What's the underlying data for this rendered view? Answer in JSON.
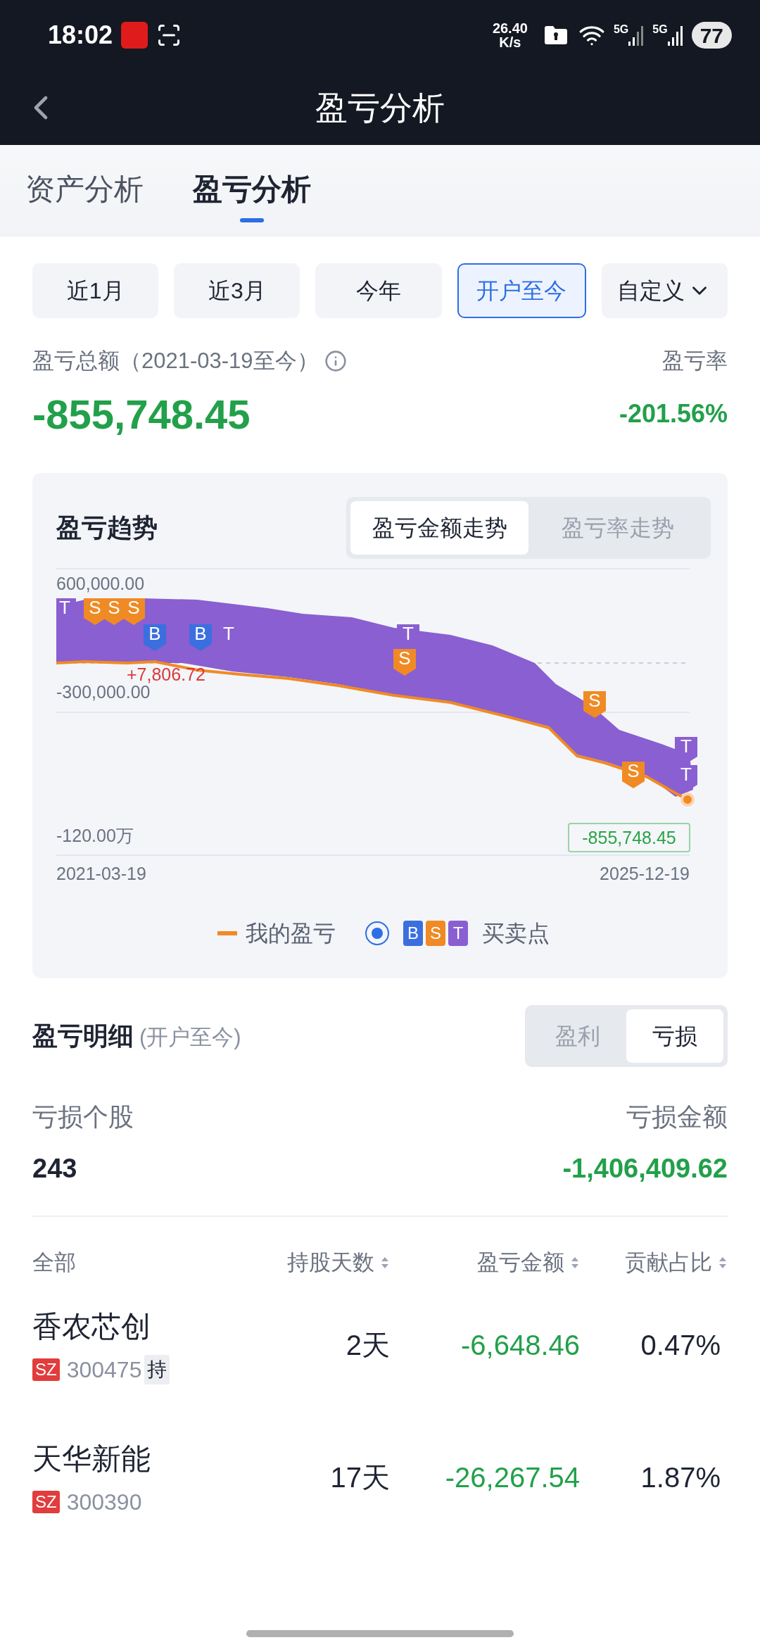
{
  "status_bar": {
    "time": "18:02",
    "speed_value": "26.40",
    "speed_unit": "K/s",
    "network_1": "5G",
    "network_2": "5G",
    "battery": "77"
  },
  "header": {
    "title": "盈亏分析"
  },
  "tabs": [
    {
      "label": "资产分析",
      "selected": false
    },
    {
      "label": "盈亏分析",
      "selected": true
    }
  ],
  "periods": [
    {
      "label": "近1月",
      "selected": false,
      "kind": "plain"
    },
    {
      "label": "近3月",
      "selected": false,
      "kind": "plain"
    },
    {
      "label": "今年",
      "selected": false,
      "kind": "plain"
    },
    {
      "label": "开户至今",
      "selected": true,
      "kind": "plain"
    },
    {
      "label": "自定义",
      "selected": false,
      "kind": "dropdown"
    }
  ],
  "summary": {
    "total_label": "盈亏总额（2021-03-19至今）",
    "total_value": "-855,748.45",
    "rate_label": "盈亏率",
    "rate_value": "-201.56%"
  },
  "trend": {
    "title": "盈亏趋势",
    "toggle": [
      {
        "label": "盈亏金额走势",
        "selected": true
      },
      {
        "label": "盈亏率走势",
        "selected": false
      }
    ],
    "y_labels": [
      "600,000.00",
      "-300,000.00",
      "-120.00万"
    ],
    "x_labels": [
      "2021-03-19",
      "2025-12-19"
    ],
    "max_label": "+7,806.72",
    "last_label": "-855,748.45",
    "markers": [
      {
        "label": "T",
        "kind": "t"
      },
      {
        "label": "S",
        "kind": "sell"
      },
      {
        "label": "S",
        "kind": "sell"
      },
      {
        "label": "S",
        "kind": "sell"
      },
      {
        "label": "B",
        "kind": "buy"
      },
      {
        "label": "B",
        "kind": "buy"
      },
      {
        "label": "T",
        "kind": "t"
      },
      {
        "label": "T",
        "kind": "t"
      },
      {
        "label": "S",
        "kind": "sell"
      },
      {
        "label": "S",
        "kind": "sell"
      },
      {
        "label": "S",
        "kind": "sell"
      },
      {
        "label": "T",
        "kind": "t"
      },
      {
        "label": "T",
        "kind": "t"
      }
    ],
    "legend": {
      "line_label": "我的盈亏",
      "show_points": true,
      "badges": [
        {
          "label": "B",
          "kind": "buy"
        },
        {
          "label": "S",
          "kind": "sell"
        },
        {
          "label": "T",
          "kind": "t"
        }
      ],
      "points_label": "买卖点"
    }
  },
  "detail": {
    "title": "盈亏明细",
    "subtitle": "(开户至今)",
    "toggle": [
      {
        "label": "盈利",
        "selected": false
      },
      {
        "label": "亏损",
        "selected": true
      }
    ],
    "count_label": "亏损个股",
    "count_value": "243",
    "amount_label": "亏损金额",
    "amount_value": "-1,406,409.62",
    "columns": [
      "全部",
      "持股天数",
      "盈亏金额",
      "贡献占比"
    ],
    "rows": [
      {
        "name": "香农芯创",
        "market": "SZ",
        "code": "300475",
        "tag": "持",
        "days": "2天",
        "amount": "-6,648.46",
        "share": "0.47%"
      },
      {
        "name": "天华新能",
        "market": "SZ",
        "code": "300390",
        "days": "17天",
        "amount": "-26,267.54",
        "share": "1.87%"
      }
    ]
  }
}
